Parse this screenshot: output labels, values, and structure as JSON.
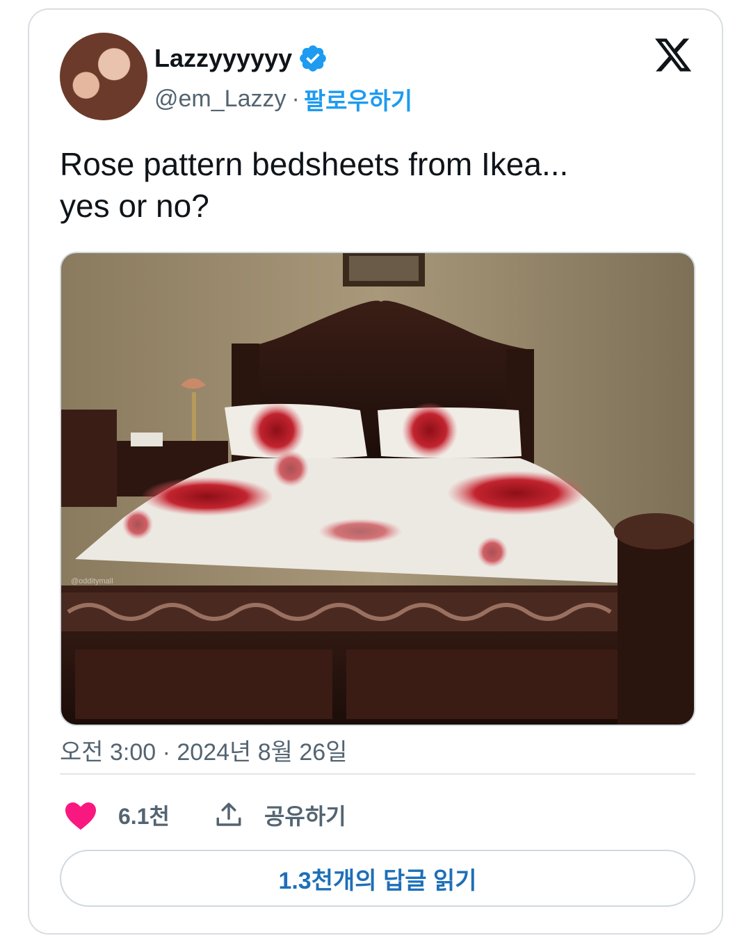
{
  "author": {
    "display_name": "Lazzyyyyyy",
    "handle": "@em_Lazzy",
    "separator": "·",
    "follow_label": "팔로우하기",
    "verified_icon": "verified-badge-icon"
  },
  "brand": {
    "logo_icon": "x-logo-icon"
  },
  "tweet": {
    "text": "Rose pattern bedsheets from Ikea...\nyes or no?",
    "image_watermark": "@odditymall",
    "timestamp": "오전 3:00 · 2024년 8월 26일"
  },
  "actions": {
    "like_icon": "heart-icon",
    "like_count": "6.1천",
    "share_icon": "share-icon",
    "share_label": "공유하기"
  },
  "replies": {
    "button_label": "1.3천개의 답글 읽기"
  },
  "colors": {
    "accent": "#1d9bf0",
    "like": "#f91880",
    "text": "#0f1419",
    "secondary": "#536471"
  }
}
